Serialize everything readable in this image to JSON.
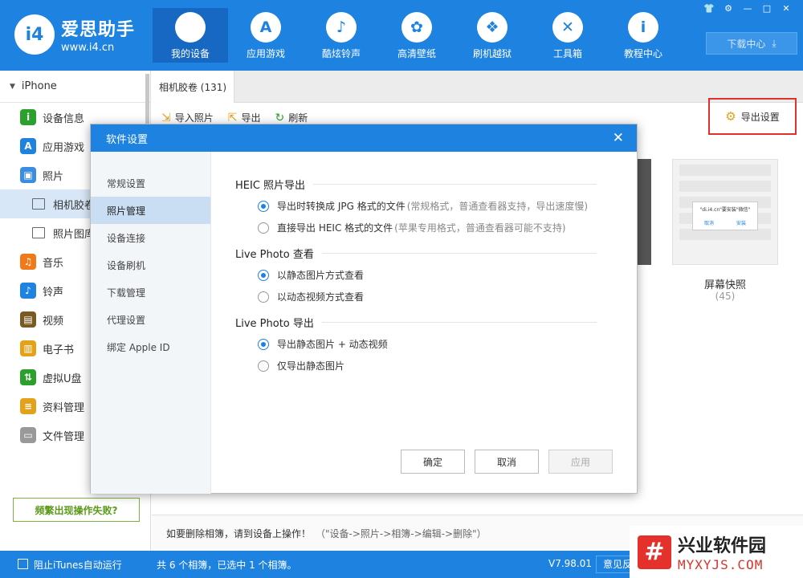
{
  "header": {
    "logo_mark": "i4",
    "app_name": "爱思助手",
    "url": "www.i4.cn",
    "nav": [
      {
        "label": "我的设备",
        "icon": "apple-icon",
        "glyph": ""
      },
      {
        "label": "应用游戏",
        "icon": "app-store-icon",
        "glyph": "A"
      },
      {
        "label": "酷炫铃声",
        "icon": "bell-icon",
        "glyph": "♪"
      },
      {
        "label": "高清壁纸",
        "icon": "flower-icon",
        "glyph": "✿"
      },
      {
        "label": "刷机越狱",
        "icon": "dropbox-icon",
        "glyph": "❖"
      },
      {
        "label": "工具箱",
        "icon": "tools-icon",
        "glyph": "✕"
      },
      {
        "label": "教程中心",
        "icon": "info-icon",
        "glyph": "i"
      }
    ],
    "download_center": "下载中心",
    "download_glyph": "⤓",
    "window_controls": [
      "👕",
      "⚙",
      "—",
      "□",
      "✕"
    ]
  },
  "sidebar": {
    "device": "iPhone",
    "items": [
      {
        "label": "设备信息",
        "icon": "info-icon",
        "color": "#2ca02c",
        "glyph": "i"
      },
      {
        "label": "应用游戏",
        "icon": "app-store-icon",
        "color": "#1e82e0",
        "glyph": "A"
      },
      {
        "label": "照片",
        "icon": "photo-icon",
        "color": "#3a8de0",
        "glyph": "▣"
      },
      {
        "label": "相机胶卷",
        "icon": "folder-icon",
        "sub": true
      },
      {
        "label": "照片图库",
        "icon": "folder-icon",
        "sub": true
      },
      {
        "label": "音乐",
        "icon": "music-icon",
        "color": "#f07a1a",
        "glyph": "♫"
      },
      {
        "label": "铃声",
        "icon": "bell-icon",
        "color": "#1e82e0",
        "glyph": "♪"
      },
      {
        "label": "视频",
        "icon": "film-icon",
        "color": "#7a5a22",
        "glyph": "▤"
      },
      {
        "label": "电子书",
        "icon": "book-icon",
        "color": "#e3a21a",
        "glyph": "▥"
      },
      {
        "label": "虚拟U盘",
        "icon": "usb-icon",
        "color": "#2ca02c",
        "glyph": "⇅"
      },
      {
        "label": "资料管理",
        "icon": "document-icon",
        "color": "#e3a21a",
        "glyph": "≡"
      },
      {
        "label": "文件管理",
        "icon": "file-icon",
        "color": "#999999",
        "glyph": "▭"
      }
    ],
    "warn_button": "频繁出现操作失败?"
  },
  "main": {
    "tab": "相机胶卷 (131)",
    "toolbar": [
      {
        "label": "导入照片",
        "icon": "import-icon",
        "glyph": "⇲"
      },
      {
        "label": "导出",
        "icon": "export-icon",
        "glyph": "⇱"
      },
      {
        "label": "刷新",
        "icon": "refresh-icon",
        "glyph": "↻"
      }
    ],
    "export_settings": "导出设置",
    "album_title": "屏幕快照",
    "album_count": "(45)",
    "thumb_popup_title": "\"di.i4.cn\"要安装\"微信\"",
    "thumb_popup_cancel": "取消",
    "thumb_popup_install": "安装",
    "hint": "如要删除相簿，请到设备上操作！",
    "hint_path": "（\"设备->照片->相簿->编辑->删除\"）"
  },
  "status": {
    "itunes": "阻止iTunes自动运行",
    "info": "共 6 个相簿，已选中 1 个相簿。",
    "version": "V7.98.01",
    "feedback": "意见反"
  },
  "watermark": {
    "logo": "#",
    "name": "兴业软件园",
    "domain": "MYXYJS.COM"
  },
  "dialog": {
    "title": "软件设置",
    "nav": [
      "常规设置",
      "照片管理",
      "设备连接",
      "设备刷机",
      "下载管理",
      "代理设置",
      "绑定 Apple ID"
    ],
    "active_nav": 1,
    "sections": [
      {
        "title": "HEIC 照片导出",
        "options": [
          {
            "label": "导出时转换成 JPG 格式的文件",
            "note": "(常规格式，普通查看器支持，导出速度慢)",
            "checked": true
          },
          {
            "label": "直接导出 HEIC 格式的文件",
            "note": "(苹果专用格式，普通查看器可能不支持)",
            "checked": false
          }
        ]
      },
      {
        "title": "Live Photo 查看",
        "options": [
          {
            "label": "以静态图片方式查看",
            "note": "",
            "checked": true
          },
          {
            "label": "以动态视频方式查看",
            "note": "",
            "checked": false
          }
        ]
      },
      {
        "title": "Live Photo 导出",
        "options": [
          {
            "label": "导出静态图片 + 动态视频",
            "note": "",
            "checked": true
          },
          {
            "label": "仅导出静态图片",
            "note": "",
            "checked": false
          }
        ]
      }
    ],
    "buttons": {
      "ok": "确定",
      "cancel": "取消",
      "apply": "应用"
    },
    "accent": "#1e82e0"
  }
}
